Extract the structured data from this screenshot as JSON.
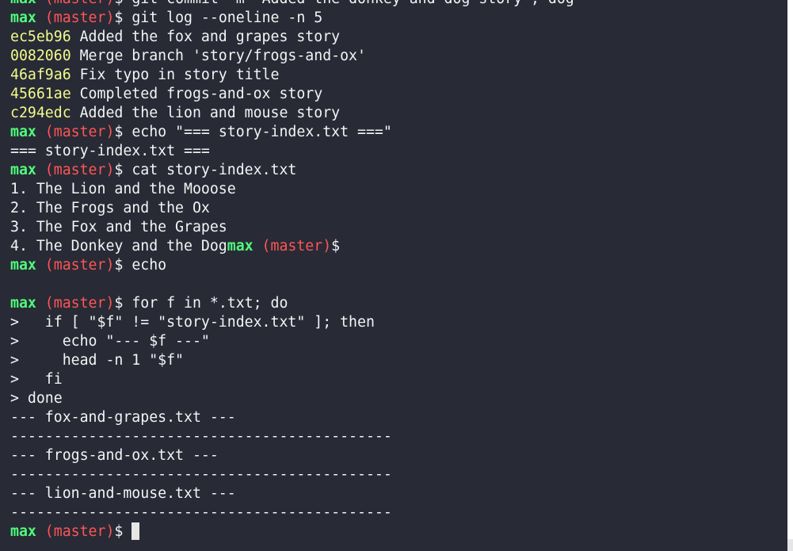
{
  "colors": {
    "background": "#282a36",
    "text": "#f4f4f4",
    "prompt_user": "#50fa7b",
    "prompt_branch": "#ff5555",
    "commit_hash": "#f1fa8c",
    "cursor": "#e6e6e6"
  },
  "terminal": {
    "lines": [
      {
        "segments": [
          {
            "t": "max",
            "c": "prompt_user",
            "b": true
          },
          {
            "t": " (master)",
            "c": "prompt_branch"
          },
          {
            "t": "$ git commit -m \"Added the donkey and dog story\"; dog",
            "c": "text"
          }
        ]
      },
      {
        "segments": [
          {
            "t": "max",
            "c": "prompt_user",
            "b": true
          },
          {
            "t": " (master)",
            "c": "prompt_branch"
          },
          {
            "t": "$ git log --oneline -n 5",
            "c": "text"
          }
        ]
      },
      {
        "segments": [
          {
            "t": "ec5eb96",
            "c": "commit_hash"
          },
          {
            "t": " Added the fox and grapes story",
            "c": "text"
          }
        ]
      },
      {
        "segments": [
          {
            "t": "0082060",
            "c": "commit_hash"
          },
          {
            "t": " Merge branch 'story/frogs-and-ox'",
            "c": "text"
          }
        ]
      },
      {
        "segments": [
          {
            "t": "46af9a6",
            "c": "commit_hash"
          },
          {
            "t": " Fix typo in story title",
            "c": "text"
          }
        ]
      },
      {
        "segments": [
          {
            "t": "45661ae",
            "c": "commit_hash"
          },
          {
            "t": " Completed frogs-and-ox story",
            "c": "text"
          }
        ]
      },
      {
        "segments": [
          {
            "t": "c294edc",
            "c": "commit_hash"
          },
          {
            "t": " Added the lion and mouse story",
            "c": "text"
          }
        ]
      },
      {
        "segments": [
          {
            "t": "max",
            "c": "prompt_user",
            "b": true
          },
          {
            "t": " (master)",
            "c": "prompt_branch"
          },
          {
            "t": "$ echo \"=== story-index.txt ===\"",
            "c": "text"
          }
        ]
      },
      {
        "segments": [
          {
            "t": "=== story-index.txt ===",
            "c": "text"
          }
        ]
      },
      {
        "segments": [
          {
            "t": "max",
            "c": "prompt_user",
            "b": true
          },
          {
            "t": " (master)",
            "c": "prompt_branch"
          },
          {
            "t": "$ cat story-index.txt",
            "c": "text"
          }
        ]
      },
      {
        "segments": [
          {
            "t": "1. The Lion and the Mooose",
            "c": "text"
          }
        ]
      },
      {
        "segments": [
          {
            "t": "2. The Frogs and the Ox",
            "c": "text"
          }
        ]
      },
      {
        "segments": [
          {
            "t": "3. The Fox and the Grapes",
            "c": "text"
          }
        ]
      },
      {
        "segments": [
          {
            "t": "4. The Donkey and the Dog",
            "c": "text"
          },
          {
            "t": "max",
            "c": "prompt_user",
            "b": true
          },
          {
            "t": " (master)",
            "c": "prompt_branch"
          },
          {
            "t": "$",
            "c": "text"
          }
        ]
      },
      {
        "segments": [
          {
            "t": "max",
            "c": "prompt_user",
            "b": true
          },
          {
            "t": " (master)",
            "c": "prompt_branch"
          },
          {
            "t": "$ echo",
            "c": "text"
          }
        ]
      },
      {
        "segments": [
          {
            "t": "",
            "c": "text"
          }
        ]
      },
      {
        "segments": [
          {
            "t": "max",
            "c": "prompt_user",
            "b": true
          },
          {
            "t": " (master)",
            "c": "prompt_branch"
          },
          {
            "t": "$ for f in *.txt; do",
            "c": "text"
          }
        ]
      },
      {
        "segments": [
          {
            "t": ">   if [ \"$f\" != \"story-index.txt\" ]; then",
            "c": "text"
          }
        ]
      },
      {
        "segments": [
          {
            "t": ">     echo \"--- $f ---\"",
            "c": "text"
          }
        ]
      },
      {
        "segments": [
          {
            "t": ">     head -n 1 \"$f\"",
            "c": "text"
          }
        ]
      },
      {
        "segments": [
          {
            "t": ">   fi",
            "c": "text"
          }
        ]
      },
      {
        "segments": [
          {
            "t": "> done",
            "c": "text"
          }
        ]
      },
      {
        "segments": [
          {
            "t": "--- fox-and-grapes.txt ---",
            "c": "text"
          }
        ]
      },
      {
        "segments": [
          {
            "t": "--------------------------------------------",
            "c": "text"
          }
        ]
      },
      {
        "segments": [
          {
            "t": "--- frogs-and-ox.txt ---",
            "c": "text"
          }
        ]
      },
      {
        "segments": [
          {
            "t": "--------------------------------------------",
            "c": "text"
          }
        ]
      },
      {
        "segments": [
          {
            "t": "--- lion-and-mouse.txt ---",
            "c": "text"
          }
        ]
      },
      {
        "segments": [
          {
            "t": "--------------------------------------------",
            "c": "text"
          }
        ]
      },
      {
        "segments": [
          {
            "t": "max",
            "c": "prompt_user",
            "b": true
          },
          {
            "t": " (master)",
            "c": "prompt_branch"
          },
          {
            "t": "$ ",
            "c": "text"
          }
        ],
        "cursor": true
      }
    ]
  }
}
